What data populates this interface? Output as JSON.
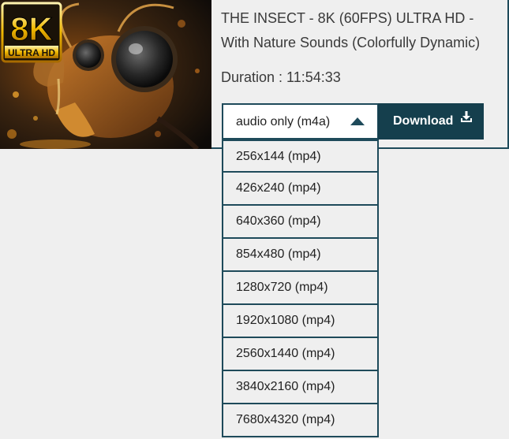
{
  "video": {
    "title": "THE INSECT - 8K (60FPS) ULTRA HD - With Nature Sounds (Colorfully Dynamic)",
    "duration_label": "Duration : 11:54:33",
    "thumbnail": {
      "badge_main": "8K",
      "badge_sub": "ULTRA HD"
    }
  },
  "format_select": {
    "selected": "audio only (m4a)",
    "expanded": true,
    "options": [
      "256x144 (mp4)",
      "426x240 (mp4)",
      "640x360 (mp4)",
      "854x480 (mp4)",
      "1280x720 (mp4)",
      "1920x1080 (mp4)",
      "2560x1440 (mp4)",
      "3840x2160 (mp4)",
      "7680x4320 (mp4)"
    ]
  },
  "download": {
    "label": "Download",
    "icon": "download-icon"
  },
  "colors": {
    "accent": "#153f4d",
    "border": "#1e4a5a",
    "background": "#efefef"
  }
}
